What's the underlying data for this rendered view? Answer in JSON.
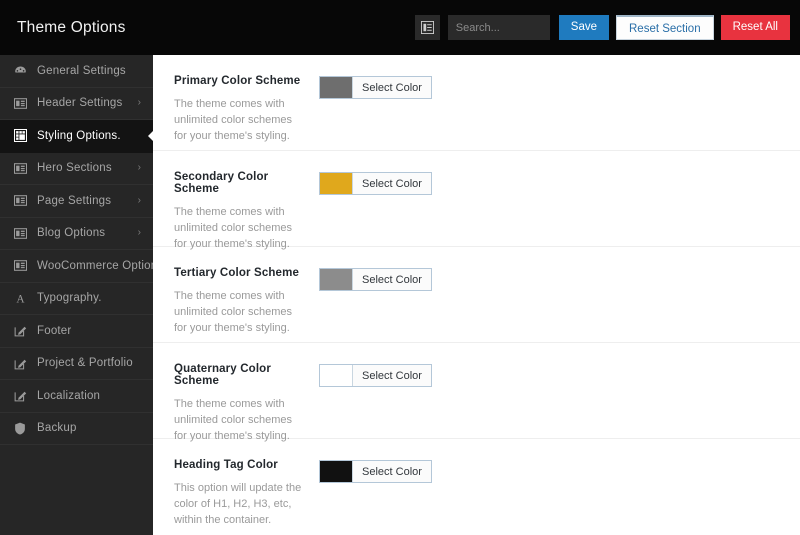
{
  "header": {
    "title": "Theme Options",
    "toggle_icon": "collapse-sidebar-icon",
    "search_placeholder": "Search...",
    "search_value": "",
    "save_label": "Save",
    "reset_section_label": "Reset Section",
    "reset_all_label": "Reset All",
    "colors": {
      "background": "#070707",
      "save": "#1f7bbf",
      "reset_section_text": "#2a6fa8",
      "reset_all": "#e8333f"
    }
  },
  "sidebar": {
    "background": "#262626",
    "active_background": "#131313",
    "items": [
      {
        "label": "General Settings",
        "icon": "dashboard-icon",
        "chevron": "",
        "active": false
      },
      {
        "label": "Header Settings",
        "icon": "layout-icon",
        "chevron": "›",
        "active": false
      },
      {
        "label": "Styling Options.",
        "icon": "styling-icon",
        "chevron": "",
        "active": true
      },
      {
        "label": "Hero Sections",
        "icon": "layout-icon",
        "chevron": "›",
        "active": false
      },
      {
        "label": "Page Settings",
        "icon": "layout-icon",
        "chevron": "›",
        "active": false
      },
      {
        "label": "Blog Options",
        "icon": "layout-icon",
        "chevron": "›",
        "active": false
      },
      {
        "label": "WooCommerce Options",
        "icon": "layout-icon",
        "chevron": "›",
        "active": false
      },
      {
        "label": "Typography.",
        "icon": "font-a-icon",
        "chevron": "",
        "active": false
      },
      {
        "label": "Footer",
        "icon": "pencil-square-icon",
        "chevron": "",
        "active": false
      },
      {
        "label": "Project & Portfolio",
        "icon": "pencil-square-icon",
        "chevron": "",
        "active": false
      },
      {
        "label": "Localization",
        "icon": "pencil-square-icon",
        "chevron": "",
        "active": false
      },
      {
        "label": "Backup",
        "icon": "shield-icon",
        "chevron": "",
        "active": false
      }
    ]
  },
  "main": {
    "select_color_label": "Select Color",
    "options": [
      {
        "title": "Primary Color Scheme",
        "description": "The theme comes with unlimited color schemes for your theme's styling.",
        "swatch": "#6e6e6e"
      },
      {
        "title": "Secondary Color Scheme",
        "description": "The theme comes with unlimited color schemes for your theme's styling.",
        "swatch": "#e0a81c"
      },
      {
        "title": "Tertiary Color Scheme",
        "description": "The theme comes with unlimited color schemes for your theme's styling.",
        "swatch": "#8c8c8c"
      },
      {
        "title": "Quaternary Color Scheme",
        "description": "The theme comes with unlimited color schemes for your theme's styling.",
        "swatch": "#ffffff"
      },
      {
        "title": "Heading Tag Color",
        "description": "This option will update the color of H1, H2, H3, etc, within the container.",
        "swatch": "#111111"
      }
    ]
  }
}
